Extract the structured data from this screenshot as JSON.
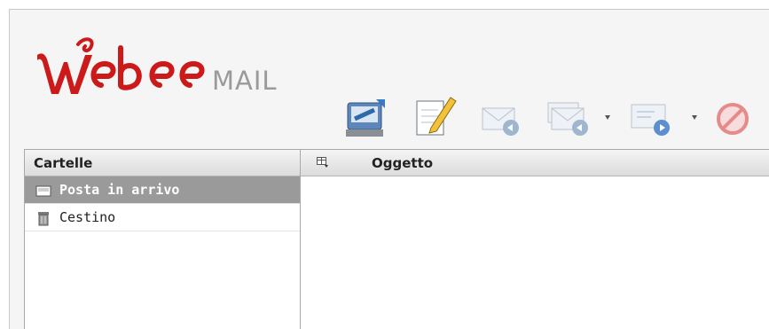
{
  "logo": {
    "brand": "Webee",
    "product": "MAIL"
  },
  "toolbar": {
    "buttons": [
      {
        "icon": "check-mail-icon"
      },
      {
        "icon": "compose-icon"
      },
      {
        "icon": "reply-icon"
      },
      {
        "icon": "reply-all-icon"
      },
      {
        "icon": "forward-icon"
      },
      {
        "icon": "delete-icon"
      }
    ]
  },
  "folders": {
    "header": "Cartelle",
    "items": [
      {
        "label": "Posta in arrivo",
        "icon": "inbox-icon",
        "selected": true
      },
      {
        "label": "Cestino",
        "icon": "trash-icon",
        "selected": false
      }
    ]
  },
  "messages": {
    "columns": {
      "subject": "Oggetto",
      "options_icon": "column-options-icon"
    },
    "rows": []
  },
  "colors": {
    "brand_red": "#cc1a1a",
    "selected_bg": "#9a9a9a"
  }
}
